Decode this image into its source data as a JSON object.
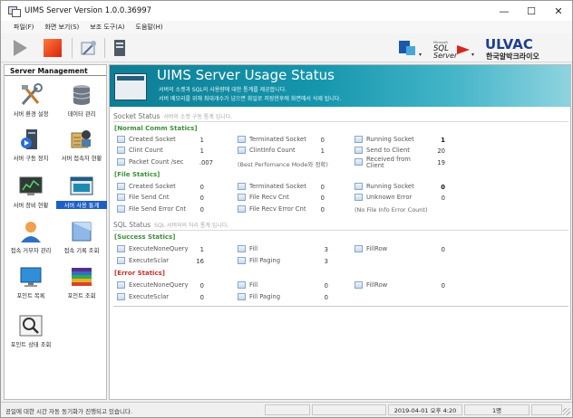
{
  "window": {
    "title": "UIMS Server Version 1.0.0.36997",
    "min": "—",
    "max": "☐",
    "close": "✕"
  },
  "menu": [
    "파일(F)",
    "화면 보기(S)",
    "보조 도구(A)",
    "도움말(H)"
  ],
  "logos": {
    "sql_small": "Microsoft",
    "sql_big": "SQL",
    "sql_server": "Server",
    "ulvac": "ULVAC",
    "ulvac_kr": "한국알박크라이오"
  },
  "sidebar": {
    "title": "Server Management",
    "items": [
      {
        "label": "서버 환경 설정"
      },
      {
        "label": "데이터 관리"
      },
      {
        "label": "서버 구동 정지"
      },
      {
        "label": "서버 접속자 현황"
      },
      {
        "label": "서버 장비 현황"
      },
      {
        "label": "서버 사용 통계"
      },
      {
        "label": "접속 거부자 관리"
      },
      {
        "label": "접속 기록 조회"
      },
      {
        "label": "포인트 목록"
      },
      {
        "label": "포인트 조회"
      },
      {
        "label": "포인트 상태 조회"
      }
    ]
  },
  "banner": {
    "title": "UIMS Server Usage Status",
    "line1": "서버의 소켓과 SQL의 사용량에 대한 통계를 제공합니다.",
    "line2": "서버 메모리를 위해 최대개수가 넘으면 화일로 저장한후에 화면에서 삭제 됩니다."
  },
  "socket": {
    "title": "Socket Status",
    "desc": "서버의 소켓 구동 통계 입니다.",
    "normal": {
      "title": "[Normal Comm Statics]",
      "col1": [
        {
          "label": "Created Socket",
          "value": "1"
        },
        {
          "label": "Clint Count",
          "value": "1"
        },
        {
          "label": "Packet Count /sec",
          "value": ".007"
        }
      ],
      "col2": [
        {
          "label": "Terminated Socket",
          "value": "0"
        },
        {
          "label": "ClintInfo Count",
          "value": "1"
        }
      ],
      "col2_note": "(Best Perfomance Mode와 정확)",
      "col3": [
        {
          "label": "Running Socket",
          "value": "1"
        },
        {
          "label": "Send to Client",
          "value": "20"
        },
        {
          "label": "Received from",
          "label2": "Client",
          "value": "19"
        }
      ]
    },
    "file": {
      "title": "[File Statics]",
      "col1": [
        {
          "label": "Created Socket",
          "value": "0"
        },
        {
          "label": "File Send Cnt",
          "value": "0"
        },
        {
          "label": "File Send Error Cnt",
          "value": "0"
        }
      ],
      "col2": [
        {
          "label": "Terminated Socket",
          "value": "0"
        },
        {
          "label": "File Recv Cnt",
          "value": "0"
        },
        {
          "label": "File Recv Error Cnt",
          "value": "0"
        }
      ],
      "col3": [
        {
          "label": "Running Socket",
          "value": "0"
        },
        {
          "label": "Unknown Error",
          "value": "0"
        }
      ],
      "col3_note": "(No File Info Error Count)"
    }
  },
  "sql": {
    "title": "SQL Status",
    "desc": "SQL 서버와의 처리 통계 입니다.",
    "success": {
      "title": "[Success Statics]",
      "col1": [
        {
          "label": "ExecuteNoneQuery",
          "value": "1"
        },
        {
          "label": "ExecuteSclar",
          "value": "16"
        }
      ],
      "col2": [
        {
          "label": "Fill",
          "value": "3"
        },
        {
          "label": "Fill Paging",
          "value": "3"
        }
      ],
      "col3": [
        {
          "label": "FillRow",
          "value": "0"
        }
      ]
    },
    "error": {
      "title": "[Error Statics]",
      "col1": [
        {
          "label": "ExecuteNoneQuery",
          "value": "0"
        },
        {
          "label": "ExecuteSclar",
          "value": "0"
        }
      ],
      "col2": [
        {
          "label": "Fill",
          "value": "0"
        },
        {
          "label": "Fill Paging",
          "value": "0"
        }
      ],
      "col3": [
        {
          "label": "FillRow",
          "value": "0"
        }
      ]
    }
  },
  "status": {
    "message": "공일에 대한 시간 자동 동기화가 진행되고 있습니다.",
    "datetime": "2019-04-01 오후 4:20",
    "users": "1명"
  }
}
